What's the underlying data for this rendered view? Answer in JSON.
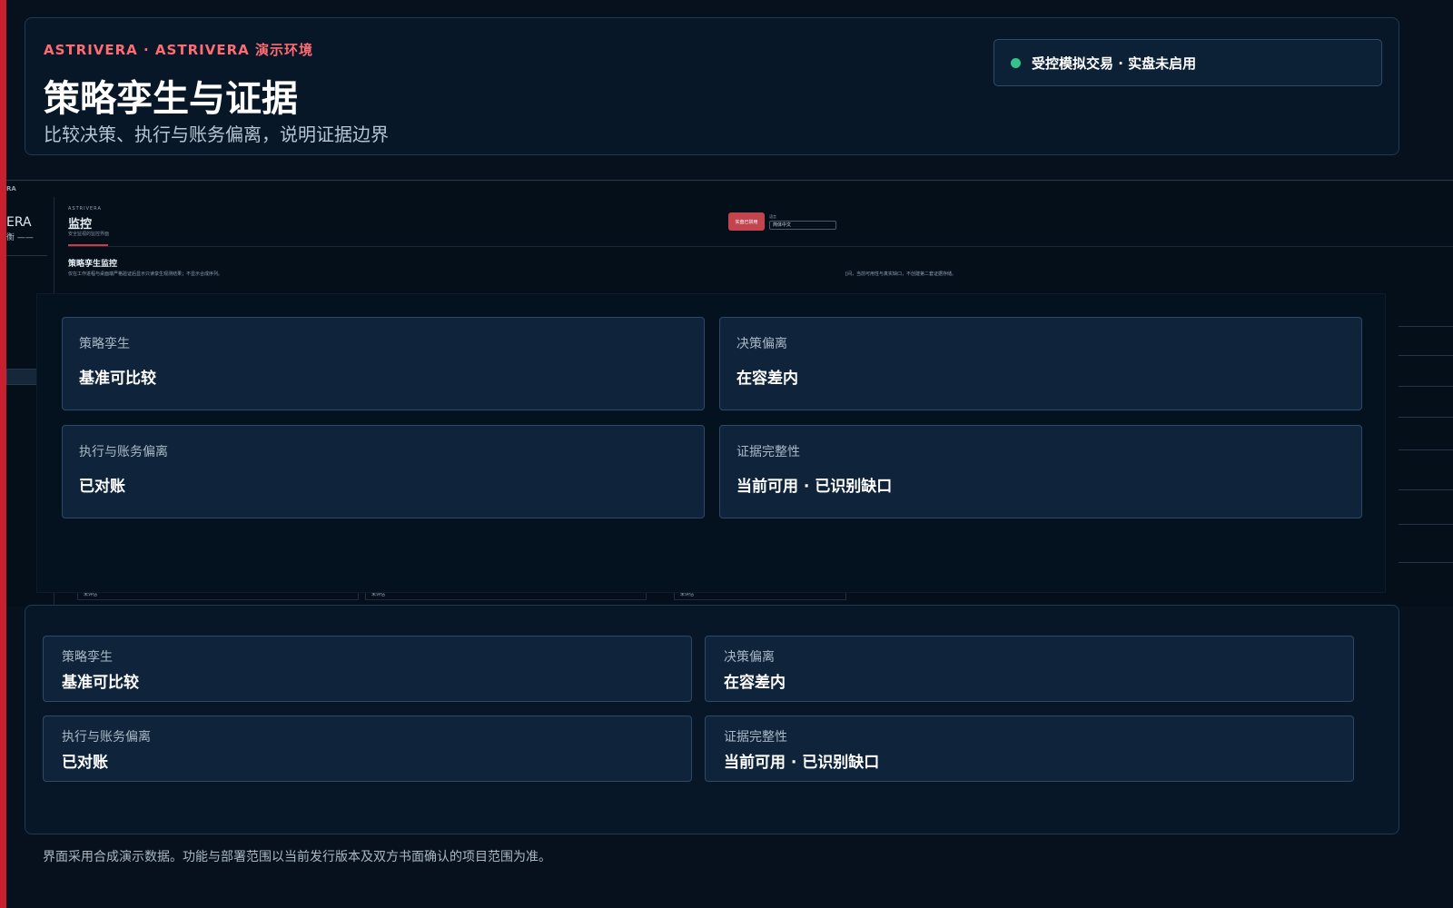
{
  "header": {
    "eyebrow": "ASTRIVERA · ASTRIVERA 演示环境",
    "title": "策略孪生与证据",
    "subtitle": "比较决策、执行与账务偏离，说明证据边界",
    "status": "受控模拟交易 · 实盘未启用"
  },
  "background_screen": {
    "corner_label": "RA",
    "brand": "ERA",
    "brand_sub": "衡 ——",
    "eyebrow": "ASTRIVERA",
    "title": "监控",
    "title_sub": "安全监视的监控界面",
    "live_button": "实盘已禁用",
    "language_label": "语言",
    "language_value": "简体中文",
    "section_title": "策略孪生监控",
    "section_note": "仅在工作进程与桌面端严格验证后显示只读孪生观测结果；不显示合成序列。",
    "section_note_right": "[间，当前可用性与真实缺口，不创建第二套证据存储。",
    "chips": [
      "未评估",
      "未评估",
      "未评估"
    ]
  },
  "overlay_cards": [
    {
      "label": "策略孪生",
      "value": "基准可比较"
    },
    {
      "label": "决策偏离",
      "value": "在容差内"
    },
    {
      "label": "执行与账务偏离",
      "value": "已对账"
    },
    {
      "label": "证据完整性",
      "value": "当前可用 · 已识别缺口"
    }
  ],
  "summary_cards": [
    {
      "label": "策略孪生",
      "value": "基准可比较"
    },
    {
      "label": "决策偏离",
      "value": "在容差内"
    },
    {
      "label": "执行与账务偏离",
      "value": "已对账"
    },
    {
      "label": "证据完整性",
      "value": "当前可用 · 已识别缺口"
    }
  ],
  "footer": {
    "note": "界面采用合成演示数据。功能与部署范围以当前发行版本及双方书面确认的项目范围为准。"
  },
  "colors": {
    "accent": "#c8202f",
    "eyebrow": "#ff6b70",
    "status_ok": "#33c48e"
  }
}
